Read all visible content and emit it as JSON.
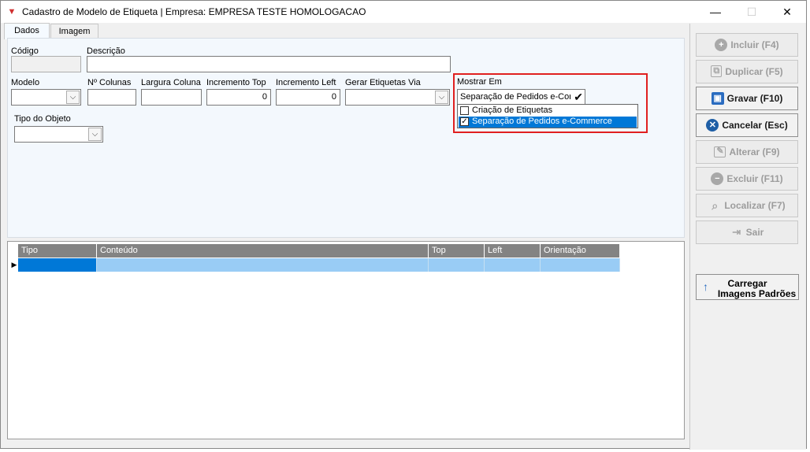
{
  "window": {
    "title": "Cadastro de Modelo de Etiqueta | Empresa: EMPRESA TESTE HOMOLOGACAO",
    "minimize": "—",
    "maximize": "☐",
    "close": "✕"
  },
  "tabs": [
    {
      "label": "Dados",
      "active": true
    },
    {
      "label": "Imagem",
      "active": false
    }
  ],
  "form": {
    "codigo_label": "Código",
    "codigo_value": "",
    "descricao_label": "Descrição",
    "descricao_value": "",
    "modelo_label": "Modelo",
    "modelo_value": "",
    "colunas_label": "Nº Colunas",
    "colunas_value": "",
    "largura_label": "Largura Coluna",
    "largura_value": "",
    "inc_top_label": "Incremento Top",
    "inc_top_value": "0",
    "inc_left_label": "Incremento Left",
    "inc_left_value": "0",
    "gerar_label": "Gerar Etiquetas Via",
    "gerar_value": "",
    "mostrar_label": "Mostrar Em",
    "mostrar_value": "Separação de Pedidos e-Con",
    "mostrar_options": [
      {
        "label": "Criação de Etiquetas",
        "checked": false,
        "selected": false
      },
      {
        "label": "Separação de Pedidos e-Commerce",
        "checked": true,
        "selected": true
      }
    ],
    "tipo_objeto_label": "Tipo do Objeto",
    "tipo_objeto_value": ""
  },
  "grid": {
    "columns": [
      "Tipo",
      "Conteúdo",
      "Top",
      "Left",
      "Orientação"
    ],
    "rows": [
      [
        "",
        "",
        "",
        "",
        ""
      ]
    ],
    "row_indicator": "▶"
  },
  "actions": [
    {
      "label": "Incluir (F4)",
      "icon": "plus-circle-icon",
      "enabled": false
    },
    {
      "label": "Duplicar (F5)",
      "icon": "duplicate-icon",
      "enabled": false
    },
    {
      "label": "Gravar (F10)",
      "icon": "save-icon",
      "enabled": true
    },
    {
      "label": "Cancelar (Esc)",
      "icon": "cancel-icon",
      "enabled": true
    },
    {
      "label": "Alterar (F9)",
      "icon": "edit-icon",
      "enabled": false
    },
    {
      "label": "Excluir (F11)",
      "icon": "minus-circle-icon",
      "enabled": false
    },
    {
      "label": "Localizar (F7)",
      "icon": "search-icon",
      "enabled": false
    },
    {
      "label": "Sair",
      "icon": "exit-icon",
      "enabled": false
    }
  ],
  "load_button": {
    "line1": "Carregar",
    "line2": "Imagens Padrões",
    "icon": "arrow-up-icon"
  },
  "colors": {
    "accent": "#0078d7",
    "highlight_border": "#e02020",
    "grid_header": "#838383",
    "grid_row": "#99ccf5",
    "cancel_icon": "#1f5fa6"
  }
}
